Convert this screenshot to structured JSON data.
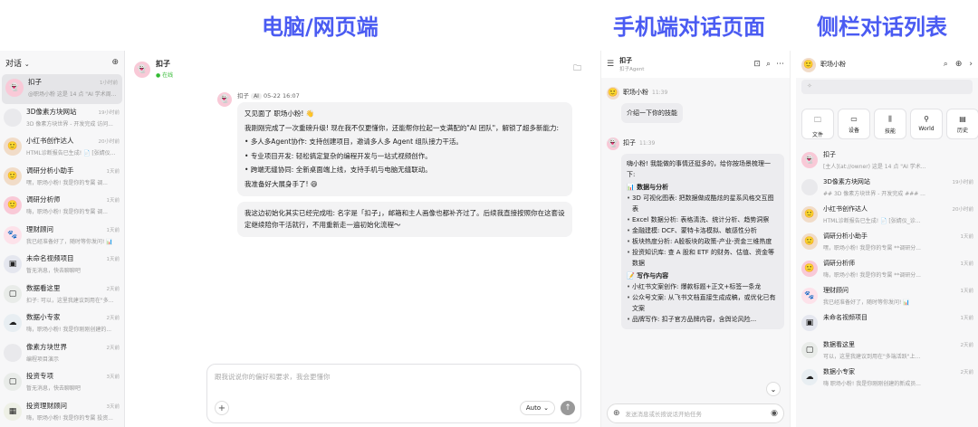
{
  "headings": {
    "desktop": "电脑/网页端",
    "mobile": "手机端对话页面",
    "sidebar": "侧栏对话列表"
  },
  "desktop": {
    "sidebar_title": "对话",
    "conversations": [
      {
        "name": "扣子",
        "preview": "@职场小粉 这是 14 点 \"AI 学术周...",
        "time": "1小时前"
      },
      {
        "name": "3D像素方块网站",
        "preview": "3D 像素方块世界 - 开发完成 访问...",
        "time": "19小时前"
      },
      {
        "name": "小红书创作达人",
        "preview": "HTML诊断报告已生成! 📄 [张婧仪...",
        "time": "20小时前"
      },
      {
        "name": "调研分析小助手",
        "preview": "嘿，职场小粉! 我是你的专属 调...",
        "time": "1天前"
      },
      {
        "name": "调研分析师",
        "preview": "嗨，职场小粉! 我是你的专属 调...",
        "time": "1天前"
      },
      {
        "name": "理财顾问",
        "preview": "我已经准备好了，随时等你发问! 📊",
        "time": "1天前"
      },
      {
        "name": "未命名视频项目",
        "preview": "暂无消息，快去聊聊吧",
        "time": "1天前"
      },
      {
        "name": "数据看这里",
        "preview": "扣子: 可以，这里我建议到用在\"多...",
        "time": "2天前"
      },
      {
        "name": "数据小专家",
        "preview": "嗨，职场小粉! 我是你刚刚创建的...",
        "time": "2天前"
      },
      {
        "name": "像素方块世界",
        "preview": "编程项目演示",
        "time": "2天前"
      },
      {
        "name": "投资专项",
        "preview": "暂无消息，快去聊聊吧",
        "time": "3天前"
      },
      {
        "name": "投资理财顾问",
        "preview": "嗨，职场小粉! 我是你的专属 投资...",
        "time": "3天前"
      }
    ],
    "chat_name": "扣子",
    "chat_status": "在线",
    "msg_sender": "扣子",
    "msg_tag": "AI",
    "msg_time": "05-22 16:07",
    "msg1": {
      "line1": "又见面了 职场小粉! 👋",
      "line2": "我刚刚完成了一次重磅升级! 现在我不仅更懂你，还能帮你拉起一支满配的\"AI 团队\"，解锁了超多新能力:",
      "bullets": [
        "多人多Agent协作: 支持创建项目，邀请多人多 Agent 组队接力干活。",
        "专业项目开发: 轻松搞定复杂的编程开发与一站式视频创作。",
        "跨端无缝协同: 全新桌面端上线，支持手机与电脑无缝联动。"
      ],
      "closing": "我准备好大展身手了! 😄"
    },
    "msg2": "我这边初始化其实已经完成啦: 名字是「扣子」，邮箱和主人画像也都补齐过了。后续我直接按照你在这套设定继续陪你干活就行，不用重新走一遍初始化流程～",
    "input_placeholder": "跟我说说你的偏好和要求，我会更懂你",
    "auto_label": "Auto"
  },
  "mobile": {
    "title": "扣子",
    "subtitle": "扣子Agent",
    "user_name": "职场小粉",
    "user_time": "11:39",
    "user_msg": "介绍一下你的技能",
    "bot_name": "扣子",
    "bot_time": "11:39",
    "intro": "嗨小粉! 我能做的事情还挺多的，给你按场景梳理一下:",
    "sections": [
      {
        "title": "📊 数据与分析",
        "items": [
          "3D 可视化图表: 把数据做成酷炫的星系风格交互图表",
          "Excel 数据分析: 表格清洗、统计分析、趋势洞察",
          "金融建模: DCF、蒙特卡洛模拟、敏感性分析",
          "板块热度分析: A股板块的政策-产业-资金三维热度",
          "投资知识库: 查 A 股和 ETF 的财务、估值、资金等数据"
        ]
      },
      {
        "title": "📝 写作与内容",
        "items": [
          "小红书文案创作: 爆款标题+正文+标签一条龙",
          "公众号文案: 从飞书文档直接生成成稿，或优化已有文案",
          "品牌写作: 扣子官方品牌内容，含舆论风险..."
        ]
      }
    ],
    "input_placeholder": "发送消息或长按说话开始任务"
  },
  "sidelist": {
    "user": "职场小粉",
    "quick": [
      {
        "icon": "folder-icon",
        "label": "文件"
      },
      {
        "icon": "device-icon",
        "label": "设备"
      },
      {
        "icon": "skill-icon",
        "label": "技能"
      },
      {
        "icon": "world-icon",
        "label": "World"
      },
      {
        "icon": "history-icon",
        "label": "历史"
      }
    ],
    "conversations": [
      {
        "name": "扣子",
        "preview": "[主人](at://owner) 这是 14 点 \"AI 学术...",
        "time": ""
      },
      {
        "name": "3D像素方块网站",
        "preview": "## 3D 像素方块世界 - 开发完成 ### ...",
        "time": "19小时前"
      },
      {
        "name": "小红书创作达人",
        "preview": "HTML诊断报告已生成! 📄 [张婧仪_诊...",
        "time": "20小时前"
      },
      {
        "name": "调研分析小助手",
        "preview": "嘿，职场小粉! 我是你的专属 **调研分...",
        "time": "1天前"
      },
      {
        "name": "调研分析师",
        "preview": "嗨，职场小粉! 我是你的专属 **调研分...",
        "time": "1天前"
      },
      {
        "name": "理财顾问",
        "preview": "我已经准备好了，随时等你发问! 📊",
        "time": "1天前"
      },
      {
        "name": "未命名视频项目",
        "preview": "",
        "time": "1天前"
      },
      {
        "name": "数据看这里",
        "preview": "可以，这里我建议到用在\"多端活跃\"上...",
        "time": "2天前"
      },
      {
        "name": "数据小专家",
        "preview": "嗨 职场小粉! 我是你刚刚创建的新成员...",
        "time": "2天前"
      }
    ]
  }
}
